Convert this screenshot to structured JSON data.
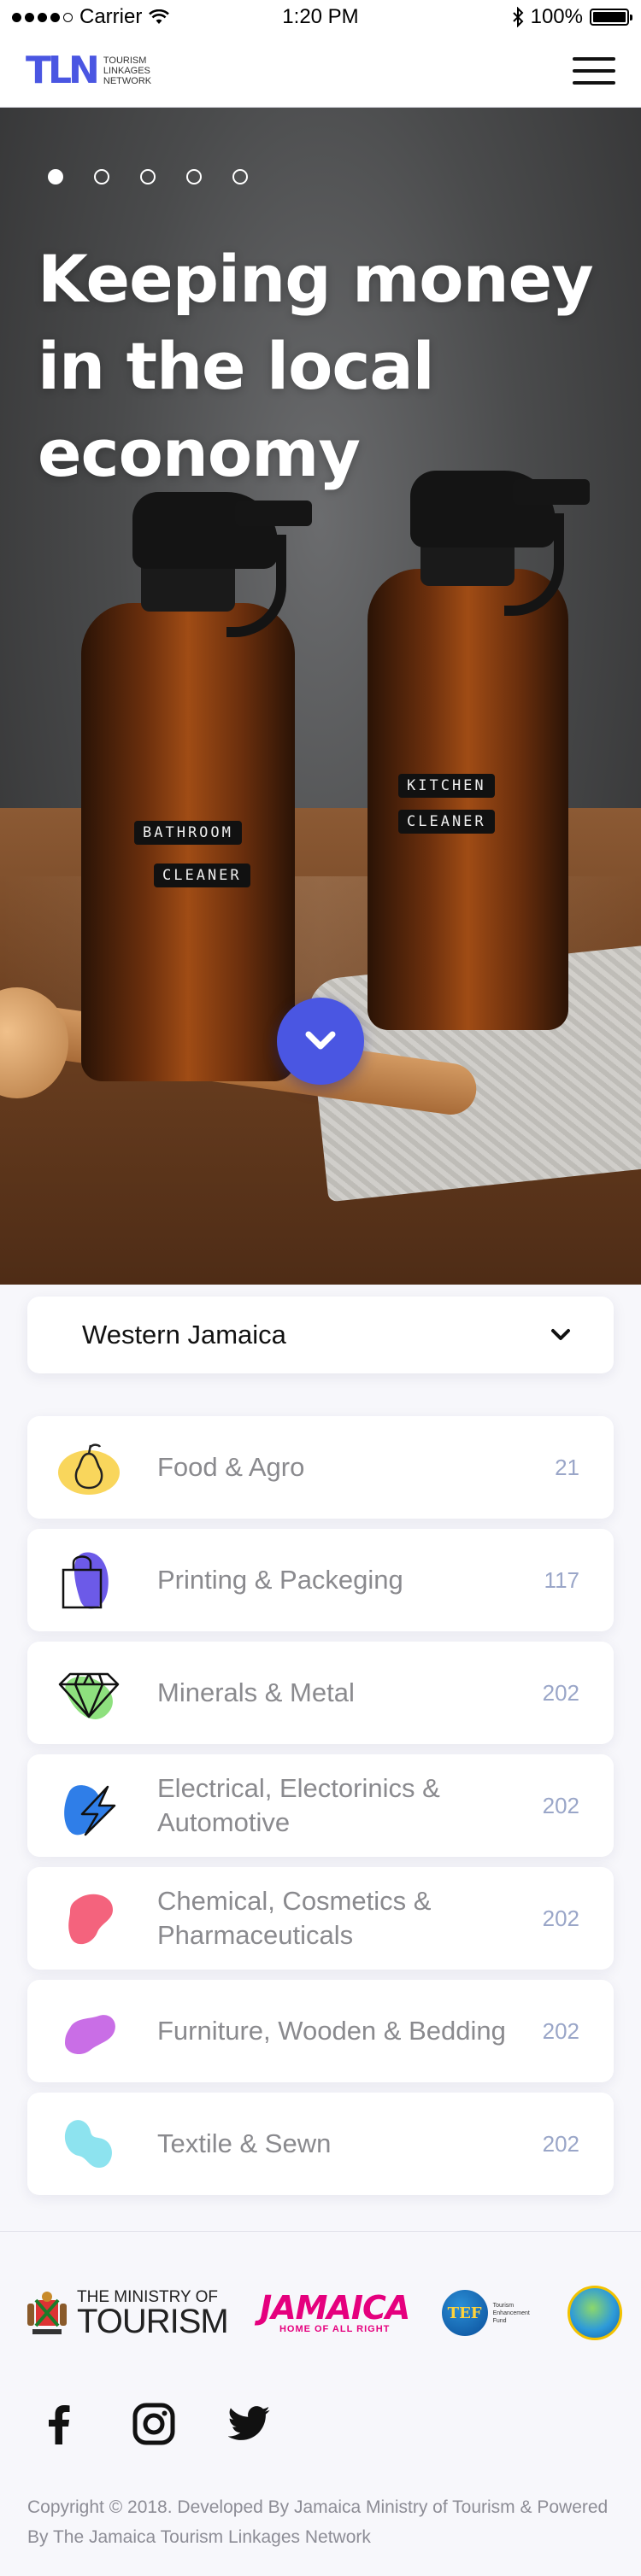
{
  "status_bar": {
    "carrier": "Carrier",
    "time": "1:20 PM",
    "battery": "100%",
    "battery_level": 1.0
  },
  "nav": {
    "logo_mark": "TLN",
    "logo_text": "Tourism Linkages Network",
    "menu_icon": "hamburger-icon"
  },
  "hero": {
    "title": "Keeping money in the local economy",
    "slides_total": 5,
    "active_slide": 1,
    "bottle_labels": [
      "BATHROOM",
      "CLEANER",
      "KITCHEN",
      "CLEANER"
    ],
    "scroll_icon": "chevron-down-icon",
    "accent": "#4a56e2"
  },
  "region": {
    "selected": "Western Jamaica",
    "icon": "chevron-down-icon"
  },
  "categories": [
    {
      "label": "Food & Agro",
      "count": "21",
      "icon": "pear-icon",
      "color": "#f9d65c"
    },
    {
      "label": "Printing & Packeging",
      "count": "117",
      "icon": "shopping-bag-icon",
      "color": "#6c5ae8"
    },
    {
      "label": "Minerals & Metal",
      "count": "202",
      "icon": "diamond-icon",
      "color": "#8ee07e"
    },
    {
      "label": "Electrical, Electorinics & Automotive",
      "count": "202",
      "icon": "lightning-icon",
      "color": "#2f7ee8"
    },
    {
      "label": "Chemical, Cosmetics & Pharmaceuticals",
      "count": "202",
      "icon": "chemical-blob-icon",
      "color": "#f4637d"
    },
    {
      "label": "Furniture, Wooden & Bedding",
      "count": "202",
      "icon": "furniture-blob-icon",
      "color": "#c96ee6"
    },
    {
      "label": "Textile & Sewn",
      "count": "202",
      "icon": "textile-blob-icon",
      "color": "#8de3ef"
    }
  ],
  "partners": {
    "ministry_line1": "THE MINISTRY OF",
    "ministry_line2": "TOURISM",
    "jamaica": "JAMAICA",
    "jamaica_tagline": "HOME OF ALL RIGHT",
    "tef": "TEF",
    "tef_text": "Tourism Enhancement Fund"
  },
  "socials": [
    "facebook-icon",
    "instagram-icon",
    "twitter-icon"
  ],
  "footer": {
    "copyright": "Copyright © 2018. Developed By Jamaica Ministry of Tourism & Powered By The Jamaica Tourism Linkages Network"
  }
}
